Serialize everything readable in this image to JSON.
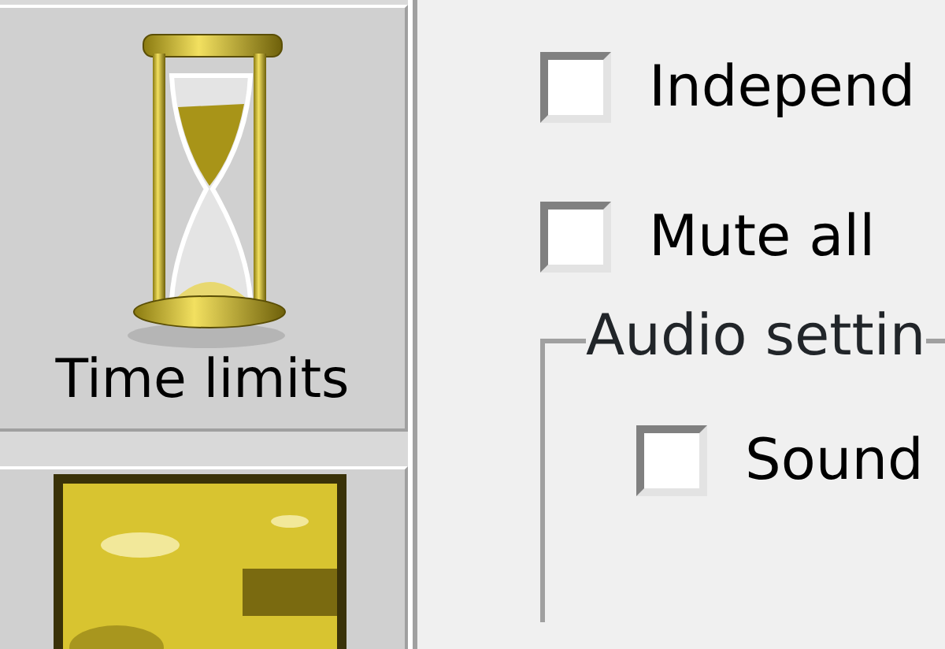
{
  "sidebar": {
    "items": [
      {
        "kind": "hourglass",
        "label": "Time limits",
        "selected": false
      },
      {
        "kind": "picture",
        "selected": false
      }
    ]
  },
  "options": [
    {
      "label": "Independ",
      "checked": false
    },
    {
      "label": "Mute all",
      "checked": false
    }
  ],
  "audio_group": {
    "title": "Audio settin",
    "options": [
      {
        "label": "Sound",
        "checked": false
      }
    ]
  }
}
